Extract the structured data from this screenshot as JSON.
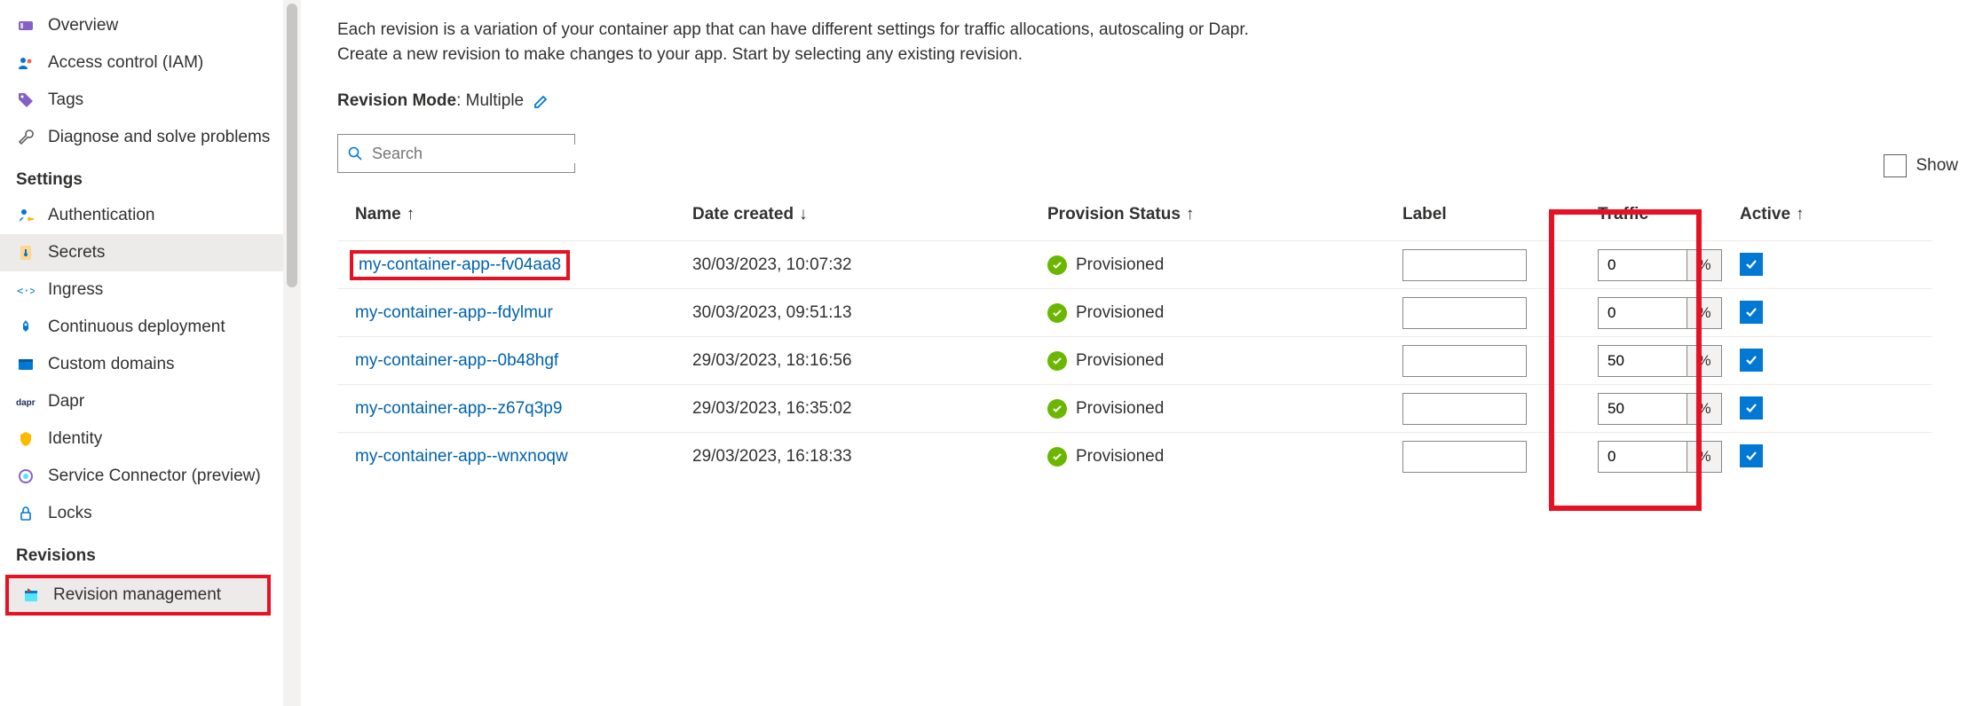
{
  "sidebar": {
    "items_top": [
      {
        "label": "Overview"
      },
      {
        "label": "Access control (IAM)"
      },
      {
        "label": "Tags"
      },
      {
        "label": "Diagnose and solve problems"
      }
    ],
    "settings_heading": "Settings",
    "items_settings": [
      {
        "label": "Authentication"
      },
      {
        "label": "Secrets"
      },
      {
        "label": "Ingress"
      },
      {
        "label": "Continuous deployment"
      },
      {
        "label": "Custom domains"
      },
      {
        "label": "Dapr"
      },
      {
        "label": "Identity"
      },
      {
        "label": "Service Connector (preview)"
      },
      {
        "label": "Locks"
      }
    ],
    "revisions_heading": "Revisions",
    "items_revisions": [
      {
        "label": "Revision management"
      }
    ]
  },
  "main": {
    "intro_line1": "Each revision is a variation of your container app that can have different settings for traffic allocations, autoscaling or Dapr.",
    "intro_line2": "Create a new revision to make changes to your app. Start by selecting any existing revision.",
    "mode_label": "Revision Mode",
    "mode_value": "Multiple",
    "search_placeholder": "Search",
    "show_label": "Show",
    "columns": {
      "name": "Name",
      "date": "Date created",
      "status": "Provision Status",
      "label": "Label",
      "traffic": "Traffic",
      "active": "Active"
    },
    "sort_arrow_up": "↑",
    "sort_arrow_down": "↓",
    "percent_symbol": "%",
    "rows": [
      {
        "name": "my-container-app--fv04aa8",
        "date": "30/03/2023, 10:07:32",
        "status": "Provisioned",
        "label": "",
        "traffic": "0",
        "active": true
      },
      {
        "name": "my-container-app--fdylmur",
        "date": "30/03/2023, 09:51:13",
        "status": "Provisioned",
        "label": "",
        "traffic": "0",
        "active": true
      },
      {
        "name": "my-container-app--0b48hgf",
        "date": "29/03/2023, 18:16:56",
        "status": "Provisioned",
        "label": "",
        "traffic": "50",
        "active": true
      },
      {
        "name": "my-container-app--z67q3p9",
        "date": "29/03/2023, 16:35:02",
        "status": "Provisioned",
        "label": "",
        "traffic": "50",
        "active": true
      },
      {
        "name": "my-container-app--wnxnoqw",
        "date": "29/03/2023, 16:18:33",
        "status": "Provisioned",
        "label": "",
        "traffic": "0",
        "active": true
      }
    ]
  }
}
